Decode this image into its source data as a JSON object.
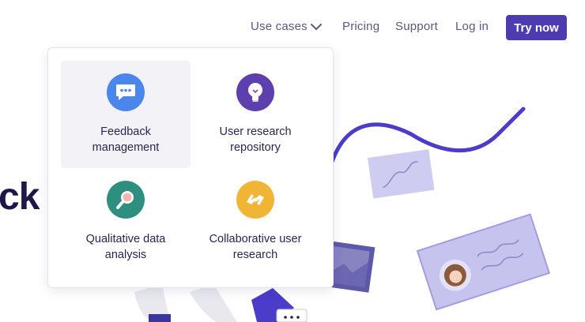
{
  "nav": {
    "use_cases": "Use cases",
    "pricing": "Pricing",
    "support": "Support",
    "login": "Log in",
    "try_now": "Try now"
  },
  "hero": {
    "partial_heading": "ck"
  },
  "dropdown": {
    "items": [
      {
        "label_line1": "Feedback",
        "label_line2": "management",
        "icon": "chat-bubble-icon",
        "color": "#4a86ec"
      },
      {
        "label_line1": "User research",
        "label_line2": "repository",
        "icon": "lightbulb-icon",
        "color": "#5d3fad"
      },
      {
        "label_line1": "Qualitative data",
        "label_line2": "analysis",
        "icon": "magnifier-icon",
        "color": "#2f8f7f"
      },
      {
        "label_line1": "Collaborative user",
        "label_line2": "research",
        "icon": "hands-icon",
        "color": "#f1b535"
      }
    ]
  },
  "colors": {
    "brand": "#4d3bb0",
    "illustration": "#4b3cc9"
  }
}
